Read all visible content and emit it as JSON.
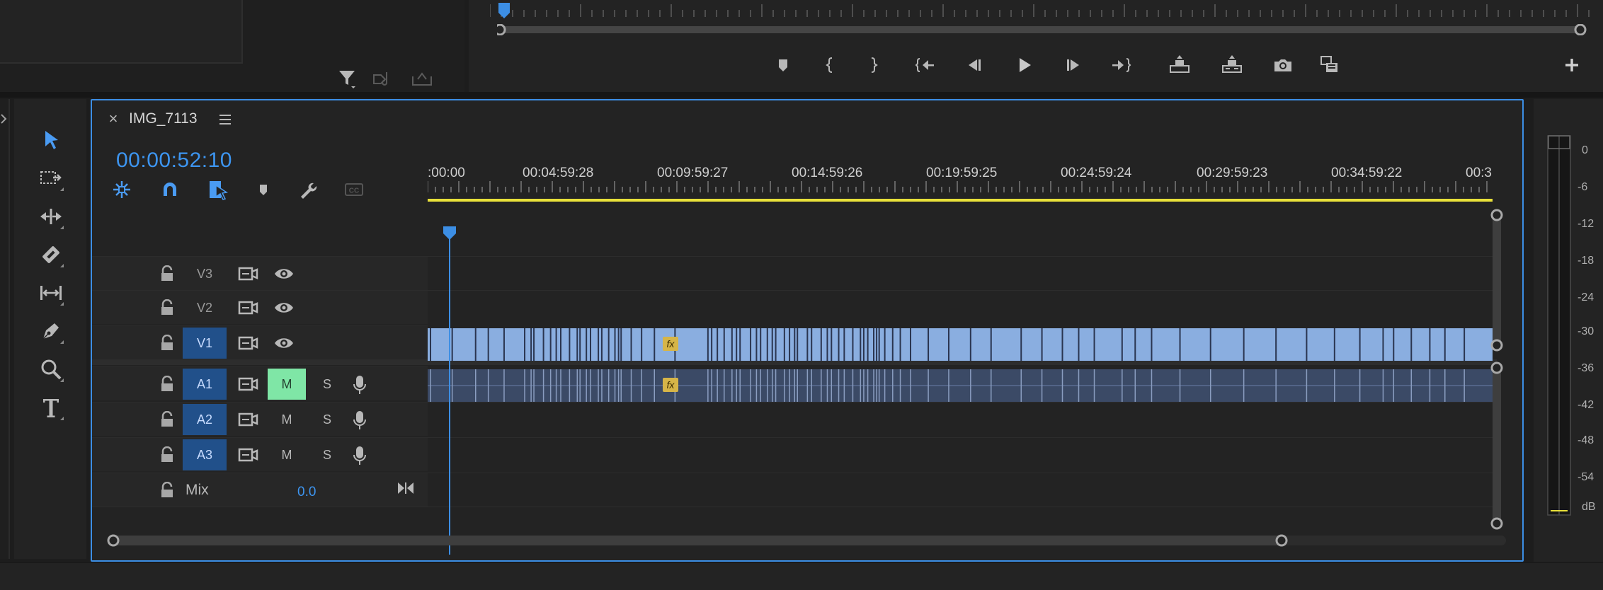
{
  "timeline": {
    "title": "IMG_7113",
    "timecode": "00:00:52:10",
    "ruler_labels": [
      ":00:00",
      "00:04:59:28",
      "00:09:59:27",
      "00:14:59:26",
      "00:19:59:25",
      "00:24:59:24",
      "00:29:59:23",
      "00:34:59:22",
      "00:3"
    ],
    "tracks": {
      "v3": "V3",
      "v2": "V2",
      "v1": "V1",
      "a1": "A1",
      "a2": "A2",
      "a3": "A3",
      "mix_label": "Mix",
      "mix_value": "0.0",
      "mute": "M",
      "solo": "S"
    },
    "fx": "fx"
  },
  "meter": {
    "scale": [
      "0",
      "-6",
      "-12",
      "-18",
      "-24",
      "-30",
      "-36",
      "-42",
      "-48",
      "-54",
      "dB"
    ]
  },
  "colors": {
    "accent": "#3c8ee4",
    "video_clip": "#8aaee0",
    "audio_clip": "#3b4a66",
    "mute_on": "#7fe6a6",
    "work_area": "#e8e03a",
    "fx_badge": "#d6b548"
  },
  "icons": {
    "monitor_controls": [
      "add-marker-icon",
      "mark-in-icon",
      "mark-out-icon",
      "go-to-in-icon",
      "step-back-icon",
      "play-icon",
      "step-forward-icon",
      "go-to-out-icon",
      "lift-icon",
      "extract-icon",
      "export-frame-icon",
      "insert-overwrite-icon",
      "add-button-icon"
    ],
    "tools": [
      "selection-tool-icon",
      "track-select-tool-icon",
      "ripple-edit-tool-icon",
      "razor-tool-icon",
      "slip-tool-icon",
      "pen-tool-icon",
      "zoom-tool-icon",
      "type-tool-icon"
    ],
    "timeline_tools": [
      "nest-sequence-icon",
      "snap-magnet-icon",
      "linked-selection-icon",
      "add-marker-icon",
      "timeline-settings-wrench-icon",
      "captions-icon"
    ]
  }
}
